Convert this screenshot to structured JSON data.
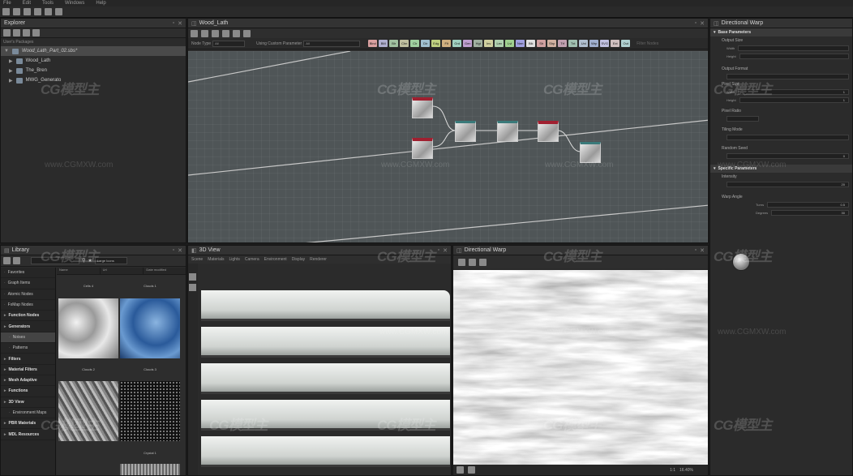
{
  "menu": [
    "File",
    "Edit",
    "Tools",
    "Windows",
    "Help"
  ],
  "explorer": {
    "title": "Explorer",
    "section_label": "User's Packages",
    "package": "Wood_Lath_Part_02.sbs*",
    "items": [
      "Wood_Lath",
      "The_Bren",
      "MWG_Generato"
    ]
  },
  "graph": {
    "title": "Wood_Lath",
    "filter_label": "Node Type",
    "filter_value": "All",
    "param_label": "Using Custom Parameter",
    "param_value": "All",
    "chips": [
      {
        "label": "Blnd",
        "color": "#d9a0a0"
      },
      {
        "label": "BM",
        "color": "#b0b0d0"
      },
      {
        "label": "Blr",
        "color": "#a0c0a0"
      },
      {
        "label": "Chn",
        "color": "#c0c0a0"
      },
      {
        "label": "Clr",
        "color": "#a0d0a0"
      },
      {
        "label": "Dir",
        "color": "#a0c0d0"
      },
      {
        "label": "Edg",
        "color": "#c0d080"
      },
      {
        "label": "Flt",
        "color": "#d0b080"
      },
      {
        "label": "Grd",
        "color": "#a0d0c0"
      },
      {
        "label": "Gen",
        "color": "#c0a0d0"
      },
      {
        "label": "Hgt",
        "color": "#a0b0a0"
      },
      {
        "label": "Inv",
        "color": "#d0d0a0"
      },
      {
        "label": "Lev",
        "color": "#b0d0b0"
      },
      {
        "label": "Lvl",
        "color": "#a0d090"
      },
      {
        "label": "Nrm",
        "color": "#a0a0e0"
      },
      {
        "label": "Blk",
        "color": "#e0e0e0"
      },
      {
        "label": "Sh",
        "color": "#d0a0a0"
      },
      {
        "label": "Shp",
        "color": "#d0b0a0"
      },
      {
        "label": "Trf",
        "color": "#c0a0b0"
      },
      {
        "label": "Txt",
        "color": "#a0c0b0"
      },
      {
        "label": "Uni",
        "color": "#b0c0d0"
      },
      {
        "label": "Wrp",
        "color": "#a0b0d0"
      },
      {
        "label": "SVG",
        "color": "#c0c0e0"
      },
      {
        "label": "Ext",
        "color": "#d0c0c0"
      },
      {
        "label": "Out",
        "color": "#b0d0d0"
      }
    ],
    "filter_search": "Filter Nodes"
  },
  "properties": {
    "title": "Directional Warp",
    "base_section": "Base Parameters",
    "output_size": "Output Size",
    "width_label": "Width",
    "height_label": "Height",
    "output_format": "Output Format",
    "pixel_size": "Pixel Size",
    "pixel_width": "Width",
    "pixel_height": "Height",
    "pixel_width_value": "1",
    "pixel_height_value": "1",
    "pixel_ratio": "Pixel Ratio",
    "tiling_mode": "Tiling Mode",
    "random_seed": "Random Seed",
    "random_seed_value": "0",
    "specific_section": "Specific Parameters",
    "intensity": "Intensity",
    "intensity_value": "20",
    "warp_angle": "Warp Angle",
    "turns_label": "Turns",
    "turns_value": "0.5",
    "degrees_label": "Degrees",
    "degrees_value": "30"
  },
  "library": {
    "title": "Library",
    "search_placeholder": "Large Icons",
    "columns": [
      "Name",
      "Url",
      "Date modified"
    ],
    "categories": [
      {
        "label": "Favorites",
        "style": "normal"
      },
      {
        "label": "Graph Items",
        "style": "normal"
      },
      {
        "label": "Atomic Nodes",
        "style": "normal"
      },
      {
        "label": "FxMap Nodes",
        "style": "normal"
      },
      {
        "label": "Function Nodes",
        "style": "bold"
      },
      {
        "label": "Generators",
        "style": "bold"
      },
      {
        "label": "Noises",
        "style": "sub-sel"
      },
      {
        "label": "Patterns",
        "style": "sub"
      },
      {
        "label": "Filters",
        "style": "bold"
      },
      {
        "label": "Material Filters",
        "style": "bold"
      },
      {
        "label": "Mesh Adaptive",
        "style": "bold"
      },
      {
        "label": "Functions",
        "style": "bold"
      },
      {
        "label": "3D View",
        "style": "bold"
      },
      {
        "label": "Environment Maps",
        "style": "sub"
      },
      {
        "label": "PBR Materials",
        "style": "bold"
      },
      {
        "label": "MDL Resources",
        "style": "bold"
      }
    ],
    "thumbs": [
      "Cells 4",
      "Clouds 1",
      "Clouds 2",
      "Clouds 3",
      "",
      "",
      "Crystal 1"
    ]
  },
  "view3d": {
    "title": "3D View",
    "menu": [
      "Scene",
      "Materials",
      "Lights",
      "Camera",
      "Environment",
      "Display",
      "Renderer"
    ]
  },
  "view2d": {
    "title": "Directional Warp",
    "zoom": "16.40%",
    "ratio": "1:1"
  },
  "watermark": {
    "logo": "CG模型主",
    "url": "www.CGMXW.com"
  },
  "colors": {
    "graph_bg": "#4f5557",
    "panel_bg": "#2b2b2b",
    "node_red": "#a02030"
  }
}
